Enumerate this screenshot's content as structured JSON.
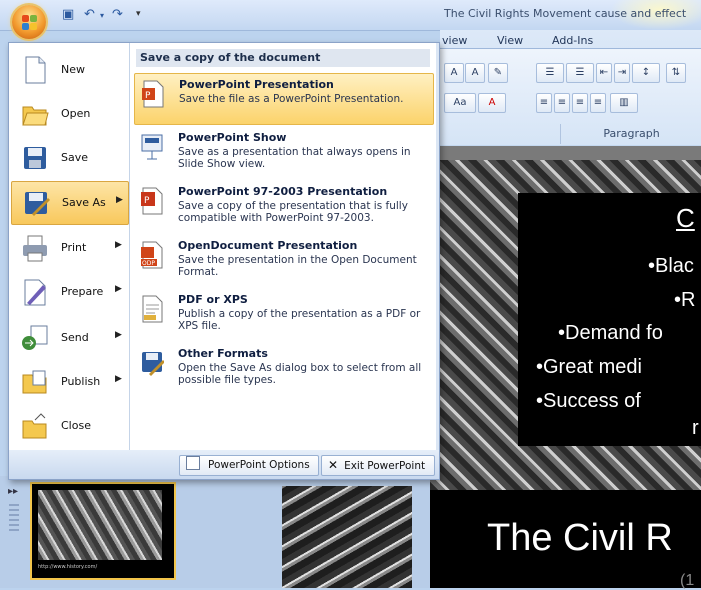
{
  "window": {
    "title": "The Civil Rights Movement cause and effect"
  },
  "ribbon": {
    "tabs": [
      "view",
      "View",
      "Add-Ins"
    ],
    "group_labels": {
      "paragraph": "Paragraph"
    }
  },
  "office_menu": {
    "items": [
      {
        "id": "new",
        "label": "New",
        "accel": "N",
        "has_submenu": false
      },
      {
        "id": "open",
        "label": "Open",
        "accel": "O",
        "has_submenu": false
      },
      {
        "id": "save",
        "label": "Save",
        "accel": "S",
        "has_submenu": false
      },
      {
        "id": "save_as",
        "label": "Save As",
        "accel": "A",
        "has_submenu": true,
        "active": true
      },
      {
        "id": "print",
        "label": "Print",
        "accel": "P",
        "has_submenu": true
      },
      {
        "id": "prepare",
        "label": "Prepare",
        "accel": "E",
        "has_submenu": true
      },
      {
        "id": "send",
        "label": "Send",
        "accel": "D",
        "has_submenu": true
      },
      {
        "id": "publish",
        "label": "Publish",
        "accel": "U",
        "has_submenu": true
      },
      {
        "id": "close",
        "label": "Close",
        "accel": "C",
        "has_submenu": false
      }
    ],
    "submenu": {
      "title": "Save a copy of the document",
      "options": [
        {
          "title": "PowerPoint Presentation",
          "description": "Save the file as a PowerPoint Presentation.",
          "active": true
        },
        {
          "title": "PowerPoint Show",
          "description": "Save as a presentation that always opens in Slide Show view."
        },
        {
          "title": "PowerPoint 97-2003 Presentation",
          "description": "Save a copy of the presentation that is fully compatible with PowerPoint 97-2003."
        },
        {
          "title": "OpenDocument Presentation",
          "description": "Save the presentation in the Open Document Format."
        },
        {
          "title": "PDF or XPS",
          "description": "Publish a copy of the presentation as a PDF or XPS file."
        },
        {
          "title": "Other Formats",
          "description": "Open the Save As dialog box to select from all possible file types."
        }
      ]
    },
    "footer": {
      "options_label": "PowerPoint Options",
      "exit_label": "Exit PowerPoint"
    }
  },
  "slide": {
    "bullets": [
      "•Blac",
      "•R",
      "•Demand fo",
      "•Great medi",
      "•Success of",
      "r"
    ],
    "heading_partial": "C",
    "next_title": "The Civil R",
    "next_sub": "(1"
  },
  "thumbnail": {
    "caption": "http://www.history.com/"
  }
}
